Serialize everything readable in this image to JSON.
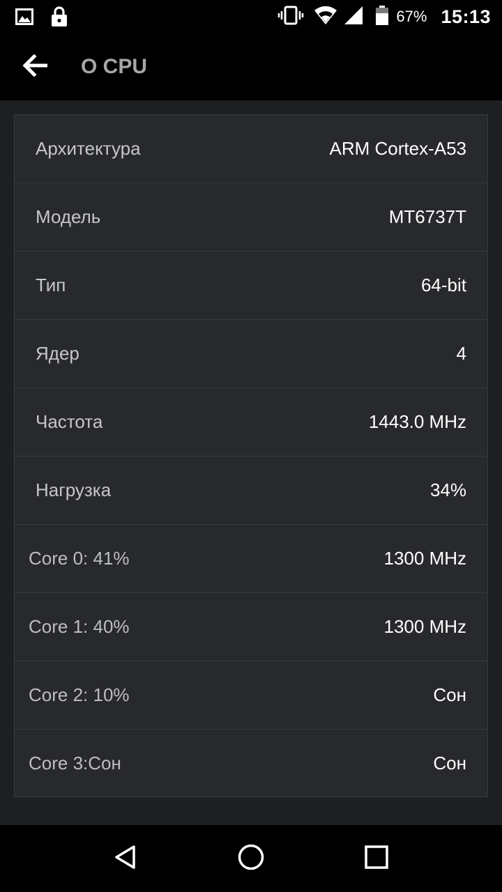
{
  "status_bar": {
    "battery_percent": "67%",
    "time": "15:13",
    "icons": [
      "image-icon",
      "lock-icon",
      "vibrate-icon",
      "wifi-icon",
      "signal-icon",
      "battery-icon"
    ]
  },
  "app_bar": {
    "title": "О CPU",
    "back_icon": "arrow-back-icon"
  },
  "rows": [
    {
      "label": "Архитектура",
      "value": "ARM Cortex-A53"
    },
    {
      "label": "Модель",
      "value": "MT6737T"
    },
    {
      "label": "Тип",
      "value": "64-bit"
    },
    {
      "label": "Ядер",
      "value": "4"
    },
    {
      "label": "Частота",
      "value": "1443.0 MHz"
    },
    {
      "label": "Нагрузка",
      "value": "34%"
    },
    {
      "label": "Core 0: 41%",
      "value": "1300 MHz"
    },
    {
      "label": "Core 1: 40%",
      "value": "1300 MHz"
    },
    {
      "label": "Core 2: 10%",
      "value": "Сон"
    },
    {
      "label": "Core 3:Сон",
      "value": "Сон"
    }
  ],
  "nav_bar": {
    "icons": [
      "nav-back-icon",
      "nav-home-icon",
      "nav-recents-icon"
    ]
  },
  "colors": {
    "background": "#1e1f21",
    "card": "#28292c",
    "bars": "#000000",
    "value_text": "#ffffff",
    "label_text": "#c6c7c9"
  }
}
